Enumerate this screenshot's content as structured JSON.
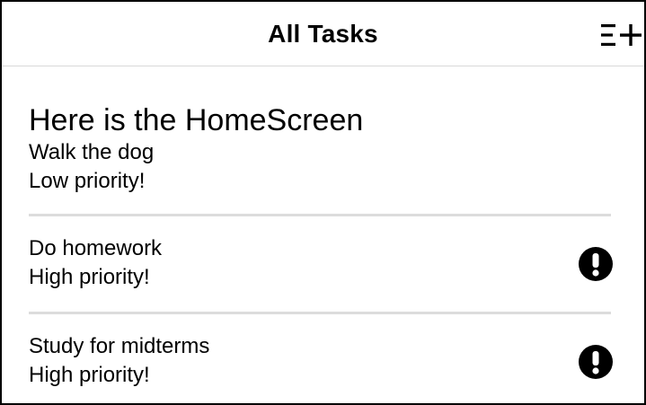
{
  "header": {
    "title": "All Tasks",
    "add_button_icon": "add-list-icon"
  },
  "screen": {
    "heading": "Here is the HomeScreen"
  },
  "tasks": [
    {
      "title": "Walk the dog",
      "priority": "Low priority!",
      "high_priority": false
    },
    {
      "title": "Do homework",
      "priority": "High priority!",
      "high_priority": true,
      "icon": "exclamation-circle-icon"
    },
    {
      "title": "Study for midterms",
      "priority": "High priority!",
      "high_priority": true,
      "icon": "exclamation-circle-icon"
    }
  ],
  "colors": {
    "divider": "#dcdcdc",
    "header_border": "#d8d8d8",
    "text": "#000000"
  }
}
